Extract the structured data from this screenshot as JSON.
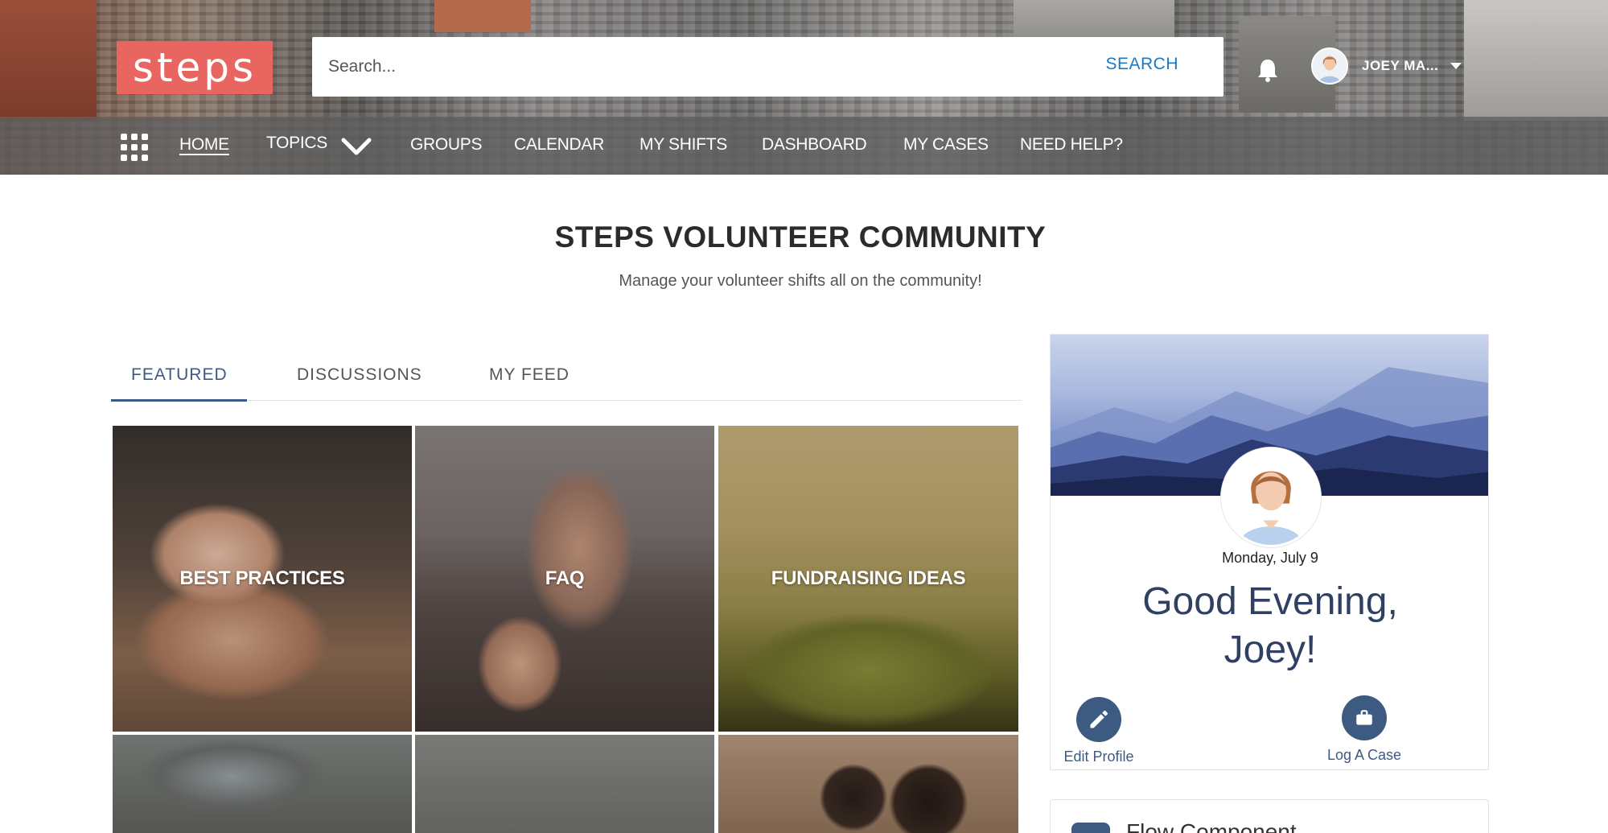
{
  "brand": {
    "logo_text": "steps",
    "logo_color": "#e8665f"
  },
  "search": {
    "placeholder": "Search...",
    "button_label": "SEARCH"
  },
  "user": {
    "name": "JOEY MA...",
    "avatar": "avatar-icon"
  },
  "nav": {
    "items": [
      {
        "label": "HOME",
        "active": true
      },
      {
        "label": "TOPICS"
      },
      {
        "label": "GROUPS"
      },
      {
        "label": "CALENDAR"
      },
      {
        "label": "MY SHIFTS"
      },
      {
        "label": "DASHBOARD"
      },
      {
        "label": "MY CASES"
      },
      {
        "label": "NEED HELP?"
      }
    ]
  },
  "hero": {
    "title": "STEPS VOLUNTEER COMMUNITY",
    "subtitle": "Manage your volunteer shifts all on the community!"
  },
  "tabs": [
    {
      "label": "FEATURED",
      "active": true
    },
    {
      "label": "DISCUSSIONS"
    },
    {
      "label": "MY FEED"
    }
  ],
  "topics": [
    {
      "label": "BEST PRACTICES"
    },
    {
      "label": "FAQ"
    },
    {
      "label": "FUNDRAISING IDEAS"
    },
    {
      "label": ""
    },
    {
      "label": ""
    },
    {
      "label": ""
    }
  ],
  "profile_card": {
    "date": "Monday, July 9",
    "greeting_line1": "Good Evening,",
    "greeting_line2": "Joey!",
    "actions": [
      {
        "label": "Edit Profile",
        "icon": "pencil-icon"
      },
      {
        "label": "Log A Case",
        "icon": "briefcase-icon"
      }
    ]
  },
  "flow": {
    "title": "Flow Component"
  },
  "colors": {
    "accent": "#3d5a80",
    "link": "#1a78c8",
    "nav_bg": "#5f5f5f"
  }
}
